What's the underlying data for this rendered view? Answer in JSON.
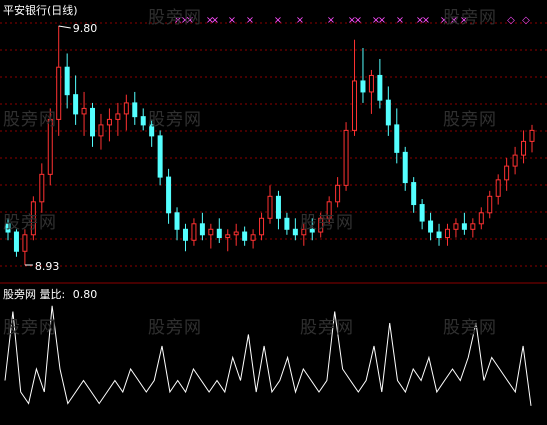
{
  "main_panel": {
    "title": "平安银行(日线)",
    "high_label": "9.80",
    "low_label": "8.93",
    "colors": {
      "up": "#ff3232",
      "down": "#54ffff",
      "grid": "#8b0000",
      "signal": "#ff4dff"
    }
  },
  "indicator_panel": {
    "label_prefix": "股旁网",
    "name": "量比:",
    "value": "0.80",
    "line_color": "#ffffff"
  },
  "watermark": "股旁网",
  "signal_markers": [
    "×",
    "◇"
  ],
  "chart_data": [
    {
      "type": "candlestick",
      "title": "平安银行(日线)",
      "ylim": [
        8.93,
        9.8
      ],
      "annotations": [
        "9.80",
        "8.93"
      ],
      "legend": "none",
      "grid": true,
      "series": [
        {
          "name": "",
          "ohlc": [
            [
              9.08,
              9.1,
              9.02,
              9.05
            ],
            [
              9.05,
              9.06,
              8.96,
              8.98
            ],
            [
              8.98,
              9.06,
              8.93,
              9.04
            ],
            [
              9.04,
              9.18,
              9.02,
              9.16
            ],
            [
              9.16,
              9.3,
              9.12,
              9.26
            ],
            [
              9.26,
              9.5,
              9.22,
              9.46
            ],
            [
              9.46,
              9.8,
              9.4,
              9.65
            ],
            [
              9.65,
              9.7,
              9.5,
              9.55
            ],
            [
              9.55,
              9.62,
              9.44,
              9.48
            ],
            [
              9.48,
              9.56,
              9.4,
              9.5
            ],
            [
              9.5,
              9.52,
              9.36,
              9.4
            ],
            [
              9.4,
              9.48,
              9.35,
              9.44
            ],
            [
              9.44,
              9.5,
              9.38,
              9.46
            ],
            [
              9.46,
              9.52,
              9.4,
              9.48
            ],
            [
              9.48,
              9.55,
              9.42,
              9.52
            ],
            [
              9.52,
              9.56,
              9.44,
              9.47
            ],
            [
              9.47,
              9.5,
              9.42,
              9.44
            ],
            [
              9.44,
              9.46,
              9.36,
              9.4
            ],
            [
              9.4,
              9.42,
              9.22,
              9.25
            ],
            [
              9.25,
              9.28,
              9.08,
              9.12
            ],
            [
              9.12,
              9.14,
              9.02,
              9.06
            ],
            [
              9.06,
              9.08,
              8.98,
              9.02
            ],
            [
              9.02,
              9.1,
              9.0,
              9.08
            ],
            [
              9.08,
              9.12,
              9.02,
              9.04
            ],
            [
              9.04,
              9.08,
              8.99,
              9.06
            ],
            [
              9.06,
              9.1,
              9.01,
              9.03
            ],
            [
              9.03,
              9.06,
              8.98,
              9.04
            ],
            [
              9.04,
              9.08,
              9.0,
              9.05
            ],
            [
              9.05,
              9.07,
              9.0,
              9.02
            ],
            [
              9.02,
              9.06,
              8.99,
              9.04
            ],
            [
              9.04,
              9.12,
              9.02,
              9.1
            ],
            [
              9.1,
              9.22,
              9.08,
              9.18
            ],
            [
              9.18,
              9.2,
              9.06,
              9.1
            ],
            [
              9.1,
              9.12,
              9.04,
              9.06
            ],
            [
              9.06,
              9.1,
              9.02,
              9.04
            ],
            [
              9.04,
              9.08,
              9.0,
              9.06
            ],
            [
              9.06,
              9.1,
              9.02,
              9.05
            ],
            [
              9.05,
              9.12,
              9.03,
              9.1
            ],
            [
              9.1,
              9.18,
              9.08,
              9.16
            ],
            [
              9.16,
              9.25,
              9.14,
              9.22
            ],
            [
              9.22,
              9.45,
              9.2,
              9.42
            ],
            [
              9.42,
              9.75,
              9.4,
              9.6
            ],
            [
              9.6,
              9.72,
              9.52,
              9.56
            ],
            [
              9.56,
              9.64,
              9.48,
              9.62
            ],
            [
              9.62,
              9.68,
              9.5,
              9.53
            ],
            [
              9.53,
              9.58,
              9.4,
              9.44
            ],
            [
              9.44,
              9.5,
              9.3,
              9.34
            ],
            [
              9.34,
              9.36,
              9.2,
              9.23
            ],
            [
              9.23,
              9.25,
              9.12,
              9.15
            ],
            [
              9.15,
              9.17,
              9.06,
              9.09
            ],
            [
              9.09,
              9.12,
              9.02,
              9.05
            ],
            [
              9.05,
              9.08,
              9.0,
              9.03
            ],
            [
              9.03,
              9.08,
              9.0,
              9.06
            ],
            [
              9.06,
              9.1,
              9.03,
              9.08
            ],
            [
              9.08,
              9.12,
              9.04,
              9.06
            ],
            [
              9.06,
              9.1,
              9.03,
              9.08
            ],
            [
              9.08,
              9.14,
              9.06,
              9.12
            ],
            [
              9.12,
              9.2,
              9.1,
              9.18
            ],
            [
              9.18,
              9.26,
              9.15,
              9.24
            ],
            [
              9.24,
              9.32,
              9.2,
              9.29
            ],
            [
              9.29,
              9.36,
              9.26,
              9.33
            ],
            [
              9.33,
              9.42,
              9.3,
              9.38
            ],
            [
              9.38,
              9.44,
              9.34,
              9.42
            ]
          ]
        }
      ]
    },
    {
      "type": "line",
      "title": "量比: 0.80",
      "ylim": [
        0,
        10
      ],
      "legend": "none",
      "series": [
        {
          "name": "量比",
          "values": [
            3,
            9,
            2,
            1,
            4,
            2,
            9.5,
            4,
            1,
            2,
            3,
            2,
            1,
            2,
            3,
            2,
            4,
            3,
            2,
            3,
            6,
            2,
            3,
            2,
            4,
            3,
            2,
            3,
            2,
            5,
            3,
            7,
            2,
            6,
            2,
            3,
            5,
            2,
            4,
            3,
            2,
            3,
            9,
            4,
            3,
            2,
            3,
            6,
            2,
            8,
            3,
            2,
            4,
            3,
            5,
            2,
            3,
            4,
            3,
            5,
            8,
            3,
            5,
            4,
            3,
            2,
            6,
            0.8
          ]
        }
      ]
    }
  ]
}
